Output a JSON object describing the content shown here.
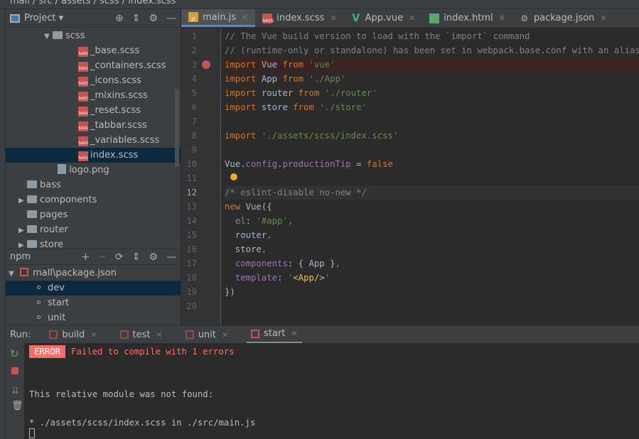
{
  "breadcrumb": "mall / src / assets / scss / index.scss",
  "project": {
    "title": "Project",
    "tree": [
      {
        "label": "scss",
        "type": "folder",
        "depth": 0,
        "arrow": "▼"
      },
      {
        "label": "_base.scss",
        "type": "sass",
        "depth": 1
      },
      {
        "label": "_containers.scss",
        "type": "sass",
        "depth": 1
      },
      {
        "label": "_icons.scss",
        "type": "sass",
        "depth": 1
      },
      {
        "label": "_mixins.scss",
        "type": "sass",
        "depth": 1
      },
      {
        "label": "_reset.scss",
        "type": "sass",
        "depth": 1
      },
      {
        "label": "_tabbar.scss",
        "type": "sass",
        "depth": 1
      },
      {
        "label": "_variables.scss",
        "type": "sass",
        "depth": 1
      },
      {
        "label": "index.scss",
        "type": "sass",
        "depth": 1,
        "selected": true
      },
      {
        "label": "logo.png",
        "type": "png",
        "depth": 0.2
      },
      {
        "label": "bass",
        "type": "folder",
        "depth": -1
      },
      {
        "label": "components",
        "type": "folder",
        "depth": -1,
        "arrow": "▶"
      },
      {
        "label": "pages",
        "type": "folder",
        "depth": -1
      },
      {
        "label": "router",
        "type": "folder",
        "depth": -1,
        "arrow": "▶"
      },
      {
        "label": "store",
        "type": "folder",
        "depth": -1,
        "arrow": "▶"
      }
    ]
  },
  "npm": {
    "title": "npm",
    "package": "mall\\package.json",
    "scripts": [
      "dev",
      "start",
      "unit"
    ]
  },
  "tabs": [
    {
      "label": "main.js",
      "icon": "js",
      "active": true
    },
    {
      "label": "index.scss",
      "icon": "sass"
    },
    {
      "label": "App.vue",
      "icon": "vue"
    },
    {
      "label": "index.html",
      "icon": "html"
    },
    {
      "label": "package.json",
      "icon": "json"
    }
  ],
  "code": [
    [
      [
        "// The Vue build version to load with the `import` command",
        "c"
      ]
    ],
    [
      [
        "// (runtime-only or standalone) has been set in webpack.base.conf with an alias.",
        "c"
      ]
    ],
    [
      [
        "import",
        "k"
      ],
      [
        " Vue ",
        "t"
      ],
      [
        "from",
        "k"
      ],
      [
        " 'vue'",
        "s"
      ]
    ],
    [
      [
        "import",
        "k"
      ],
      [
        " App ",
        "t"
      ],
      [
        "from",
        "k"
      ],
      [
        " './App'",
        "s"
      ]
    ],
    [
      [
        "import",
        "k"
      ],
      [
        " router ",
        "t"
      ],
      [
        "from",
        "k"
      ],
      [
        " './router'",
        "s"
      ]
    ],
    [
      [
        "import",
        "k"
      ],
      [
        " store ",
        "t"
      ],
      [
        "from",
        "k"
      ],
      [
        " './store'",
        "s"
      ]
    ],
    [],
    [
      [
        "import",
        "k"
      ],
      [
        " './assets/scss/index.scss'",
        "s"
      ]
    ],
    [],
    [
      [
        "Vue.",
        "t"
      ],
      [
        "config",
        "p"
      ],
      [
        ".",
        "t"
      ],
      [
        "productionTip",
        "p"
      ],
      [
        " = ",
        "t"
      ],
      [
        "false",
        "k"
      ]
    ],
    [],
    [
      [
        "/* eslint-disable no-new */",
        "c"
      ]
    ],
    [
      [
        "new",
        "k"
      ],
      [
        " Vue({",
        "t"
      ]
    ],
    [
      [
        "  ",
        "t"
      ],
      [
        "el",
        "p"
      ],
      [
        ": ",
        "t"
      ],
      [
        "'#app'",
        "s"
      ],
      [
        ",",
        "k"
      ]
    ],
    [
      [
        "  router",
        "t"
      ],
      [
        ",",
        "k"
      ]
    ],
    [
      [
        "  store",
        "t"
      ],
      [
        ",",
        "k"
      ]
    ],
    [
      [
        "  ",
        "t"
      ],
      [
        "components",
        "p"
      ],
      [
        ": { App }",
        "t"
      ],
      [
        ",",
        "k"
      ]
    ],
    [
      [
        "  ",
        "t"
      ],
      [
        "template",
        "p"
      ],
      [
        ": ",
        "t"
      ],
      [
        "'",
        "s"
      ],
      [
        "<App/>",
        "sy"
      ],
      [
        "'",
        "s"
      ]
    ],
    [
      [
        "})",
        "t"
      ]
    ],
    []
  ],
  "breakpoint_line": 3,
  "current_line": 12,
  "run": {
    "label": "Run:",
    "tabs": [
      "build",
      "test",
      "unit",
      "start"
    ],
    "active": "start"
  },
  "console": {
    "badge": "ERROR",
    "error": "Failed to compile with 1 errors",
    "lines": [
      "This relative module was not found:",
      "* ./assets/scss/index.scss in ./src/main.js"
    ]
  }
}
